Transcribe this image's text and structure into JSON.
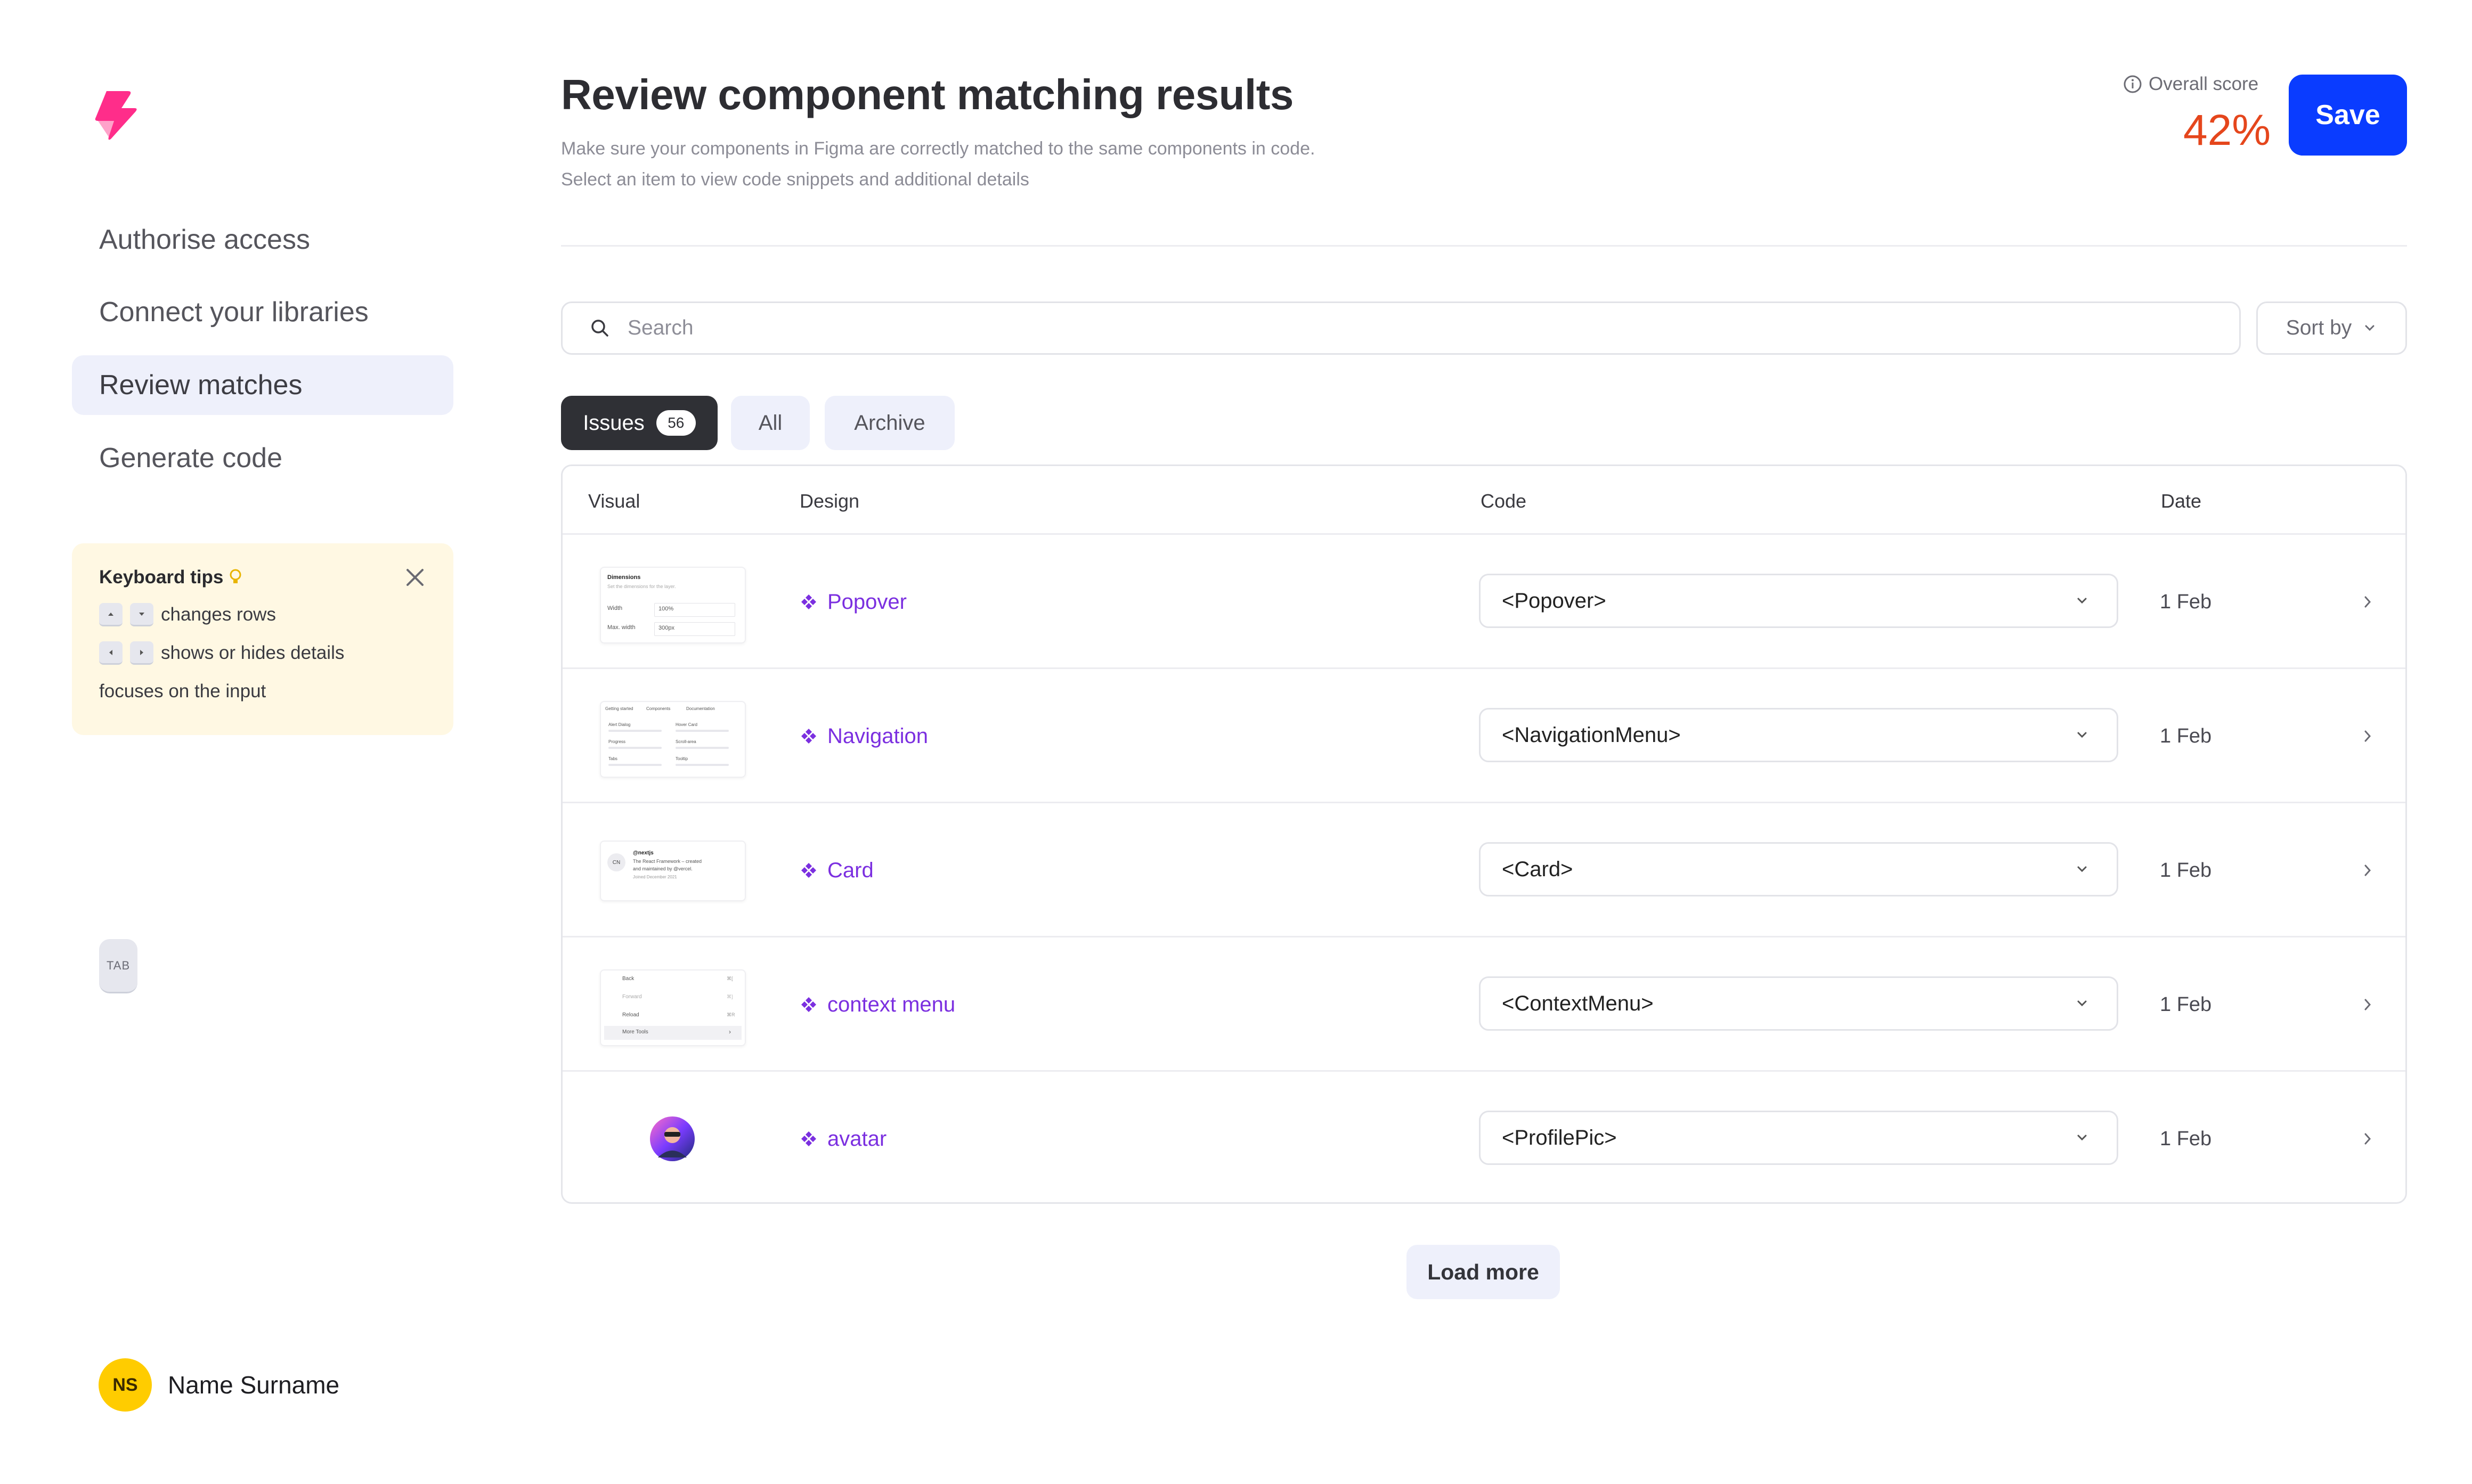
{
  "sidebar": {
    "nav": [
      {
        "label": "Authorise access",
        "active": false
      },
      {
        "label": "Connect your libraries",
        "active": false
      },
      {
        "label": "Review matches",
        "active": true
      },
      {
        "label": "Generate code",
        "active": false
      }
    ],
    "tips": {
      "title": "Keyboard tips",
      "rows": [
        {
          "keys": [
            "arrow-up-icon",
            "arrow-down-icon"
          ],
          "text": "changes rows"
        },
        {
          "keys": [
            "arrow-left-icon",
            "arrow-right-icon"
          ],
          "text": "shows or hides details"
        },
        {
          "key_label": "TAB",
          "text": "focuses on the input"
        }
      ]
    },
    "user": {
      "initials": "NS",
      "name": "Name Surname"
    }
  },
  "header": {
    "title": "Review component matching results",
    "subtitle_line1": "Make sure your components in Figma are correctly matched to the same components in code.",
    "subtitle_line2": "Select an item to view code snippets and additional details",
    "score_label": "Overall score",
    "score_value": "42%",
    "save_label": "Save"
  },
  "search": {
    "placeholder": "Search",
    "value": ""
  },
  "sort": {
    "label": "Sort by"
  },
  "tabs": [
    {
      "label": "Issues",
      "count": "56",
      "active": true
    },
    {
      "label": "All",
      "active": false
    },
    {
      "label": "Archive",
      "active": false
    }
  ],
  "table": {
    "columns": {
      "visual": "Visual",
      "design": "Design",
      "code": "Code",
      "date": "Date"
    },
    "rows": [
      {
        "design": "Popover",
        "code": "<Popover>",
        "date": "1 Feb"
      },
      {
        "design": "Navigation",
        "code": "<NavigationMenu>",
        "date": "1 Feb"
      },
      {
        "design": "Card",
        "code": "<Card>",
        "date": "1 Feb"
      },
      {
        "design": "context menu",
        "code": "<ContextMenu>",
        "date": "1 Feb"
      },
      {
        "design": "avatar",
        "code": "<ProfilePic>",
        "date": "1 Feb"
      }
    ]
  },
  "thumbs": {
    "popover": {
      "title": "Dimensions",
      "desc": "Set the dimensions for the layer.",
      "r1_label": "Width",
      "r1_value": "100%",
      "r2_label": "Max. width",
      "r2_value": "300px"
    },
    "navigation": {
      "tab1": "Getting started",
      "tab2": "Components",
      "tab3": "Documentation",
      "c1": "Alert Dialog",
      "c2": "Hover Card",
      "c3": "Progress",
      "c4": "Scroll-area",
      "c5": "Tabs",
      "c6": "Tooltip"
    },
    "card": {
      "avatar": "CN",
      "handle": "@nextjs",
      "line1": "The React Framework – created",
      "line2": "and maintained by @vercel.",
      "joined": "Joined December 2021"
    },
    "context": {
      "i1": "Back",
      "k1": "⌘[",
      "i2": "Forward",
      "k2": "⌘]",
      "i3": "Reload",
      "k3": "⌘R",
      "i4": "More Tools",
      "k4": "›"
    }
  },
  "load_more_label": "Load more",
  "colors": {
    "accent": "#0a3cff",
    "score": "#e5461c",
    "design_link": "#7b2fe0",
    "tips_bg": "#fff8e3",
    "active_tab": "#2f3035"
  }
}
